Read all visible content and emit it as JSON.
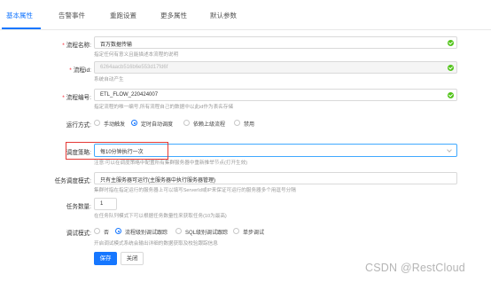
{
  "tabs": [
    {
      "label": "基本属性",
      "active": true
    },
    {
      "label": "告警事件",
      "active": false
    },
    {
      "label": "重跑设置",
      "active": false
    },
    {
      "label": "更多属性",
      "active": false
    },
    {
      "label": "默认参数",
      "active": false
    }
  ],
  "form": {
    "flow_name": {
      "label": "流程名称:",
      "value": "百万数据传输",
      "help": "指定任何有意义且能描述本流程的说明"
    },
    "flow_id": {
      "label": "流程id:",
      "value": "6264aacb516b6e553d17fd6f",
      "help": "系统自动产生"
    },
    "flow_code": {
      "label": "流程编号:",
      "value": "ETL_FLOW_220424007",
      "help": "指定流程的唯一编号,所有流程自己的数据中以此id作为表名存储"
    },
    "run_mode": {
      "label": "运行方式:",
      "options": [
        "手动触发",
        "定时自动调度",
        "依赖上级流程",
        "禁用"
      ],
      "selected": "定时自动调度"
    },
    "schedule": {
      "label": "调度策略:",
      "value": "每10分钟执行一次",
      "help": "注意:可以在调度策略中配置所有集群服务器中重新推举节点(打开生效)"
    },
    "server": {
      "label": "任务调度模式:",
      "value": "只有主服务器可运行(主服务器中执行服务器管理)",
      "help": "集群时指在指定运行的服务器上可以填写ServerId或IP来保证可运行的服务器多个用逗号分隔"
    },
    "task_count": {
      "label": "任务数量:",
      "value": "1",
      "help": "在任务队列模式下可以根据任务数量性来获取任务(10为最高)"
    },
    "debug_mode": {
      "label": "调试模式:",
      "options": [
        "否",
        "流程级别调试跟踪",
        "SQL级别调试跟踪",
        "单步调试"
      ],
      "selected": "流程级别调试跟踪",
      "help": "开启调试模式系统会输出详细的数据获取及校验跟踪信息"
    },
    "save_label": "保存",
    "close_label": "关闭"
  },
  "watermark": "CSDN @RestCloud",
  "colors": {
    "primary": "#1677ff",
    "success": "#52c41a",
    "highlight": "#e53935",
    "required": "#f5222d"
  }
}
